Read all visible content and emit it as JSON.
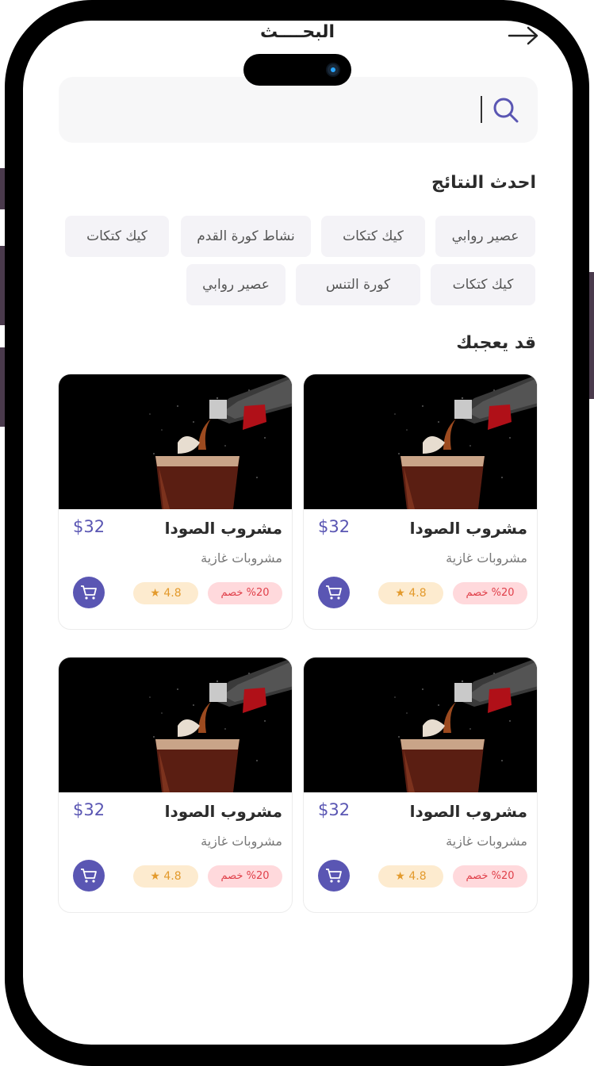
{
  "header": {
    "title": "البحــــث"
  },
  "search": {
    "placeholder": ""
  },
  "recent": {
    "title": "احدث النتائج",
    "chips": [
      "عصير روابي",
      "كيك كتكات",
      "نشاط كورة القدم",
      "كيك كتكات",
      "كيك كتكات",
      "كورة التنس",
      "عصير روابي"
    ]
  },
  "suggested": {
    "title": "قد يعجبك",
    "products": [
      {
        "name": "مشروب الصودا",
        "category": "مشروبات غازية",
        "price": "$32",
        "discount": "%20 خصم",
        "rating": "4.8",
        "image_icon": "soda-bottle-pouring-image"
      },
      {
        "name": "مشروب الصودا",
        "category": "مشروبات غازية",
        "price": "$32",
        "discount": "%20 خصم",
        "rating": "4.8",
        "image_icon": "soda-bottle-pouring-image"
      },
      {
        "name": "مشروب الصودا",
        "category": "مشروبات غازية",
        "price": "$32",
        "discount": "%20 خصم",
        "rating": "4.8",
        "image_icon": "soda-bottle-pouring-image"
      },
      {
        "name": "مشروب الصودا",
        "category": "مشروبات غازية",
        "price": "$32",
        "discount": "%20 خصم",
        "rating": "4.8",
        "image_icon": "soda-bottle-pouring-image"
      }
    ]
  },
  "colors": {
    "accent": "#5a56b3",
    "discount_bg": "#ffd9dc",
    "discount_text": "#e0404a",
    "rating_bg": "#fdebcf",
    "rating_text": "#e39a2c"
  }
}
